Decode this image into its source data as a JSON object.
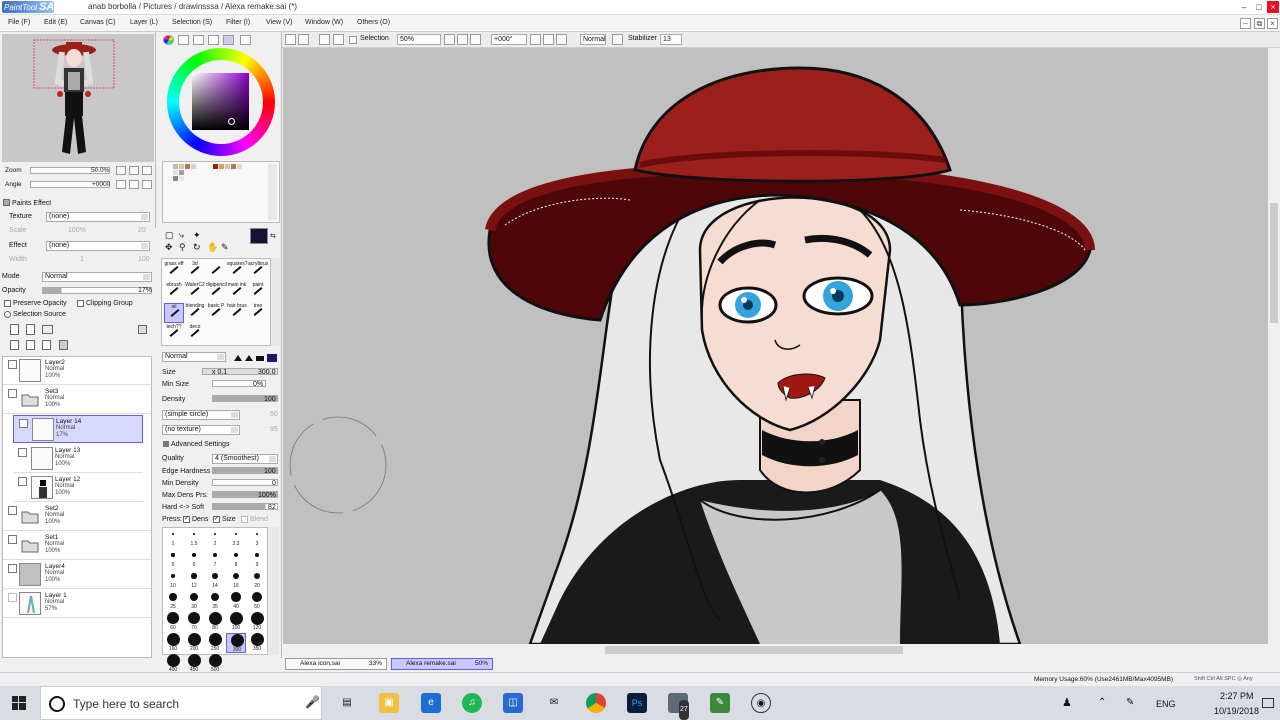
{
  "window": {
    "app_name": "PaintTool",
    "app_short": "SAI",
    "title": "anab borbolla / Pictures / drawinsssa / Alexa remake.sai (*)"
  },
  "menu": [
    "File (F)",
    "Edit (E)",
    "Canvas (C)",
    "Layer (L)",
    "Selection (S)",
    "Filter (I)",
    "View (V)",
    "Window (W)",
    "Others (O)"
  ],
  "toolbar": {
    "selection_label": "Selection",
    "zoom": "50%",
    "rotation": "+000°",
    "blend": "Normal",
    "stabilizer_label": "Stabilizer",
    "stabilizer_value": "13"
  },
  "navigator": {
    "zoom_label": "Zoom",
    "zoom_value": "50.0%",
    "angle_label": "Angle",
    "angle_value": "+0000"
  },
  "paper_effect": {
    "header": "Paints Effect",
    "texture_label": "Texture",
    "texture_value": "(none)",
    "scale_label": "Scale",
    "scale_value": "100%",
    "scale_num": "20",
    "effect_label": "Effect",
    "effect_value": "(none)",
    "width_label": "Width",
    "width_value": "1",
    "width_num": "100"
  },
  "layer_props": {
    "mode_label": "Mode",
    "mode_value": "Normal",
    "opacity_label": "Opacity",
    "opacity_value": "17%",
    "preserve_opacity": "Preserve Opacity",
    "clipping_group": "Clipping Group",
    "selection_source": "Selection Source"
  },
  "layers": [
    {
      "name": "Layer2",
      "mode": "Normal",
      "opacity": "100%",
      "selected": false,
      "folder": false
    },
    {
      "name": "Set3",
      "mode": "Normal",
      "opacity": "100%",
      "selected": false,
      "folder": true
    },
    {
      "name": "Layer 14",
      "mode": "Normal",
      "opacity": "17%",
      "selected": true,
      "folder": false
    },
    {
      "name": "Layer 13",
      "mode": "Normal",
      "opacity": "100%",
      "selected": false,
      "folder": false
    },
    {
      "name": "Layer 12",
      "mode": "Normal",
      "opacity": "100%",
      "selected": false,
      "folder": false
    },
    {
      "name": "Set2",
      "mode": "Normal",
      "opacity": "100%",
      "selected": false,
      "folder": true
    },
    {
      "name": "Set1",
      "mode": "Normal",
      "opacity": "100%",
      "selected": false,
      "folder": true
    },
    {
      "name": "Layer4",
      "mode": "Normal",
      "opacity": "100%",
      "selected": false,
      "folder": false
    },
    {
      "name": "Layer 1",
      "mode": "Normal",
      "opacity": "57%",
      "selected": false,
      "folder": false
    }
  ],
  "tools": {
    "brush_names": [
      "grass eff",
      "3d",
      "",
      "squares?",
      "acrylbrus",
      "ebrush",
      "WaterC2",
      "digipencil",
      "main ink",
      "paint",
      "oil",
      "blending",
      "basic P",
      "hair brus",
      "tree",
      "tech??",
      "deco"
    ],
    "mode": "Normal",
    "size_label": "Size",
    "size_mult": "x 0.1",
    "size_value": "300.0",
    "min_size_label": "Min Size",
    "min_size_value": "0%",
    "density_label": "Density",
    "density_value": "100",
    "shape": "(simple circle)",
    "shape_num": "50",
    "texture": "(no texture)",
    "texture_num": "95",
    "advanced_header": "Advanced Settings",
    "quality_label": "Quality",
    "quality_value": "4 (Smoothest)",
    "edge_label": "Edge Hardness",
    "edge_value": "100",
    "min_density_label": "Min Density",
    "min_density_value": "0",
    "max_dens_label": "Max Dens Prs.",
    "max_dens_value": "100%",
    "hard_soft_label": "Hard <-> Soft",
    "hard_soft_value": "82",
    "press_label": "Press:",
    "dens_label": "Dens",
    "size_check_label": "Size",
    "blend_label": "Blend",
    "brush_sizes": [
      "1",
      "1.5",
      "2",
      "2.3",
      "3",
      "5",
      "6",
      "7",
      "8",
      "9",
      "10",
      "12",
      "14",
      "16",
      "20",
      "25",
      "30",
      "35",
      "40",
      "50",
      "60",
      "70",
      "80",
      "100",
      "120",
      "160",
      "200",
      "250",
      "300",
      "350",
      "400",
      "450",
      "500"
    ],
    "brush_sizes_selected": "300"
  },
  "doc_tabs": [
    {
      "name": "Alexa icon.sai",
      "zoom": "33%",
      "active": false
    },
    {
      "name": "Alexa remake.sai",
      "zoom": "50%",
      "active": true
    }
  ],
  "status": {
    "memory": "Memory Usage:60% (Use2461MB/Max4095MB)",
    "keys": "Shift Ctrl Alt SPC ◎ Any"
  },
  "taskbar": {
    "search_placeholder": "Type here to search",
    "lang": "ENG",
    "time": "2:27 PM",
    "date": "10/19/2018",
    "badge": "27"
  },
  "colors": {
    "accent": "#0063b1",
    "hat": "#9b1f1a",
    "hat_dark": "#4e0708",
    "skin": "#f7dcd2",
    "eye": "#33a4dc",
    "hair": "#e8e8e8",
    "shirt_dark": "#1a1a1a",
    "shirt_light": "#c8c8c8",
    "canvas_bg": "#c0c0c0",
    "selected_swatch": "#1a1032"
  }
}
